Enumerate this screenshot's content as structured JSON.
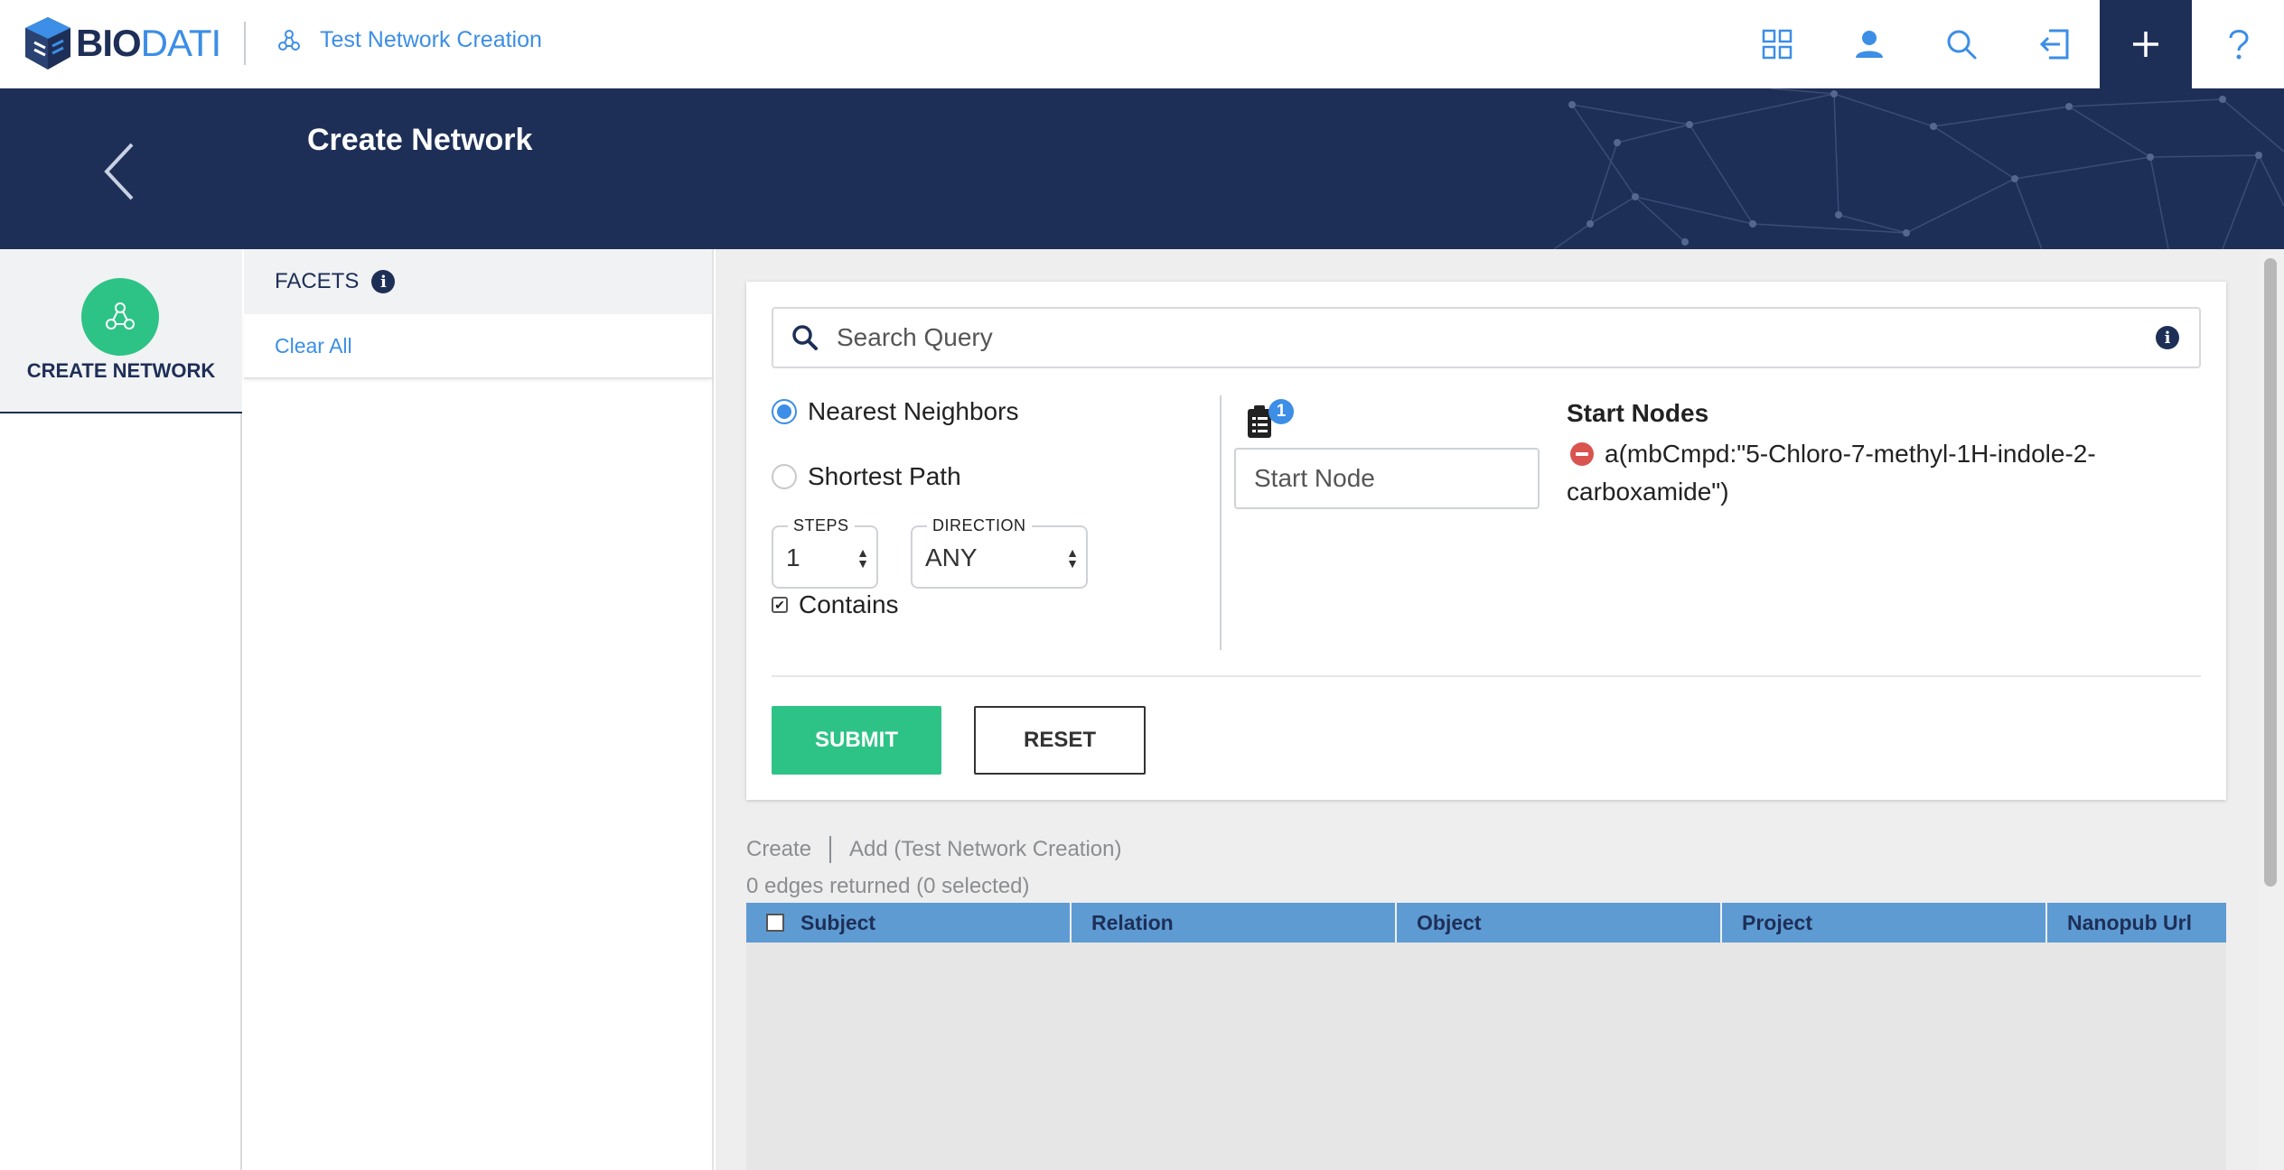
{
  "app": {
    "logo_text_bio": "BIO",
    "logo_text_dati": "DATI",
    "breadcrumb": "Test Network Creation"
  },
  "topbar_icons": [
    "grid-icon",
    "user-icon",
    "search-icon",
    "exit-icon",
    "plus-icon",
    "help-icon"
  ],
  "banner": {
    "title": "Create Network"
  },
  "leftnav": {
    "create_network_label": "CREATE NETWORK"
  },
  "facets": {
    "title": "FACETS",
    "info": "i",
    "clear_all": "Clear All"
  },
  "query": {
    "search_placeholder": "Search Query",
    "info": "i",
    "mode_nearest": "Nearest Neighbors",
    "mode_shortest": "Shortest Path",
    "selected_mode": "Nearest Neighbors",
    "steps_label": "STEPS",
    "steps_value": "1",
    "direction_label": "DIRECTION",
    "direction_value": "ANY",
    "contains_label": "Contains",
    "contains_checked": true,
    "start_node_placeholder": "Start Node",
    "clipboard_badge": "1",
    "start_nodes_title": "Start Nodes",
    "start_nodes": [
      "a(mbCmpd:\"5-Chloro-7-methyl-1H-indole-2-carboxamide\")"
    ],
    "submit_label": "SUBMIT",
    "reset_label": "RESET"
  },
  "results": {
    "tab_create": "Create",
    "tab_add": "Add (Test Network Creation)",
    "count_text": "0 edges returned (0 selected)",
    "columns": [
      "Subject",
      "Relation",
      "Object",
      "Project",
      "Nanopub Url"
    ]
  },
  "colors": {
    "navy": "#1e2f57",
    "accent_blue": "#3c8ee6",
    "green": "#2ec386",
    "table_header": "#5e9bd3",
    "remove_red": "#d9534f"
  }
}
